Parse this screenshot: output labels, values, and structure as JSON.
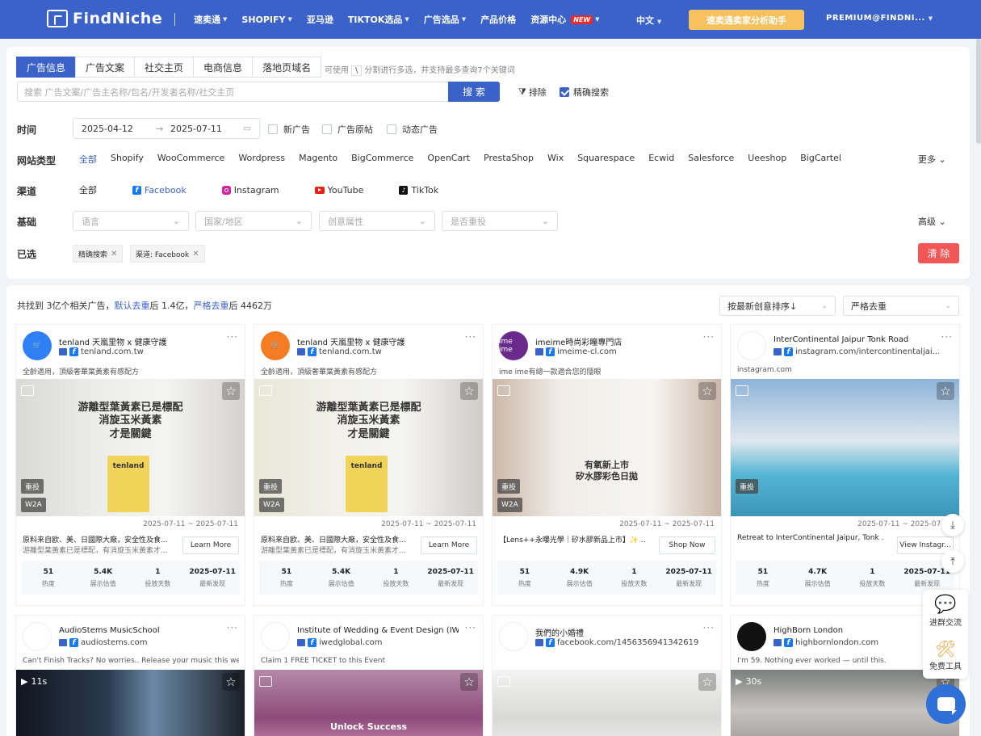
{
  "nav": {
    "logo": "FindNiche",
    "menu": [
      {
        "label": "速卖通",
        "dropdown": true
      },
      {
        "label": "SHOPIFY",
        "dropdown": true
      },
      {
        "label": "亚马逊",
        "dropdown": false
      },
      {
        "label": "TIKTOK选品",
        "dropdown": true
      },
      {
        "label": "广告选品",
        "dropdown": true
      },
      {
        "label": "产品价格",
        "dropdown": false
      },
      {
        "label": "资源中心",
        "dropdown": true,
        "badge": "NEW"
      }
    ],
    "lang": "中文",
    "cta": "速卖通卖家分析助手",
    "user": "PREMIUM@FINDNI..."
  },
  "filters": {
    "tabs": [
      "广告信息",
      "广告文案",
      "社交主页",
      "电商信息",
      "落地页域名"
    ],
    "active_tab": 0,
    "hint_prefix": "可使用",
    "hint_key": "\\",
    "hint_suffix": "分割进行多选，并支持最多查询7个关键词",
    "search_placeholder": "搜索 广告文案/广告主名称/包名/开发者名称/社交主页",
    "search_button": "搜 索",
    "exclude_label": "排除",
    "exact_label": "精确搜索",
    "time_label": "时间",
    "date_start": "2025-04-12",
    "date_end": "2025-07-11",
    "time_options": [
      "新广告",
      "广告原帖",
      "动态广告"
    ],
    "site_label": "网站类型",
    "site_types": [
      "全部",
      "Shopify",
      "WooCommerce",
      "Wordpress",
      "Magento",
      "BigCommerce",
      "OpenCart",
      "PrestaShop",
      "Wix",
      "Squarespace",
      "Ecwid",
      "Salesforce",
      "Ueeshop",
      "BigCartel"
    ],
    "more": "更多",
    "channel_label": "渠道",
    "channels": {
      "all": "全部",
      "facebook": "Facebook",
      "instagram": "Instagram",
      "youtube": "YouTube",
      "tiktok": "TikTok"
    },
    "basic_label": "基础",
    "selects": [
      "语言",
      "国家/地区",
      "创意属性",
      "是否重投"
    ],
    "advanced": "高级",
    "selected_label": "已选",
    "chips": [
      "精确搜索",
      "渠道: Facebook"
    ],
    "clear": "清 除"
  },
  "results": {
    "summary_a": "共找到 3亿个相关广告，",
    "summary_link1": "默认去重",
    "summary_b": "后 1.4亿，",
    "summary_link2": "严格去重",
    "summary_c": "后 4462万",
    "sort": "按最新创意排序↓",
    "dedupe": "严格去重",
    "stat_labels": [
      "热度",
      "展示估值",
      "投放天数",
      "最新发现"
    ]
  },
  "cards": [
    {
      "name": "tenland 天嵐里物 x 健康守護",
      "domain": "tenland.com.tw",
      "desc": "全齡適用，頂級奢華葉黃素有感配方",
      "badges": [
        "重投",
        "W2A"
      ],
      "range": "2025-07-11 ~ 2025-07-11",
      "t1": "原料来自欧、美、日國際大廠，安全性及食...",
      "t2": "游離型葉黃素已是標配，有消旋玉米黃素才...",
      "cta": "Learn More",
      "stats": [
        "51",
        "5.4K",
        "1",
        "2025-07-11"
      ],
      "image_text": "游離型葉黃素已是標配\n消旋玉米黃素\n才是關鍵",
      "product": "tenland",
      "avatar_color": "#2f7ff5"
    },
    {
      "name": "tenland 天嵐里物 x 健康守護",
      "domain": "tenland.com.tw",
      "desc": "全齡適用，頂級奢華葉黃素有感配方",
      "badges": [
        "重投",
        "W2A"
      ],
      "range": "2025-07-11 ~ 2025-07-11",
      "t1": "原料来自欧、美、日國際大廠，安全性及食...",
      "t2": "游離型葉黃素已是標配，有消旋玉米黃素才...",
      "cta": "Learn More",
      "stats": [
        "51",
        "5.4K",
        "1",
        "2025-07-11"
      ],
      "image_text": "游離型葉黃素已是標配\n消旋玉米黃素\n才是關鍵",
      "product": "tenland",
      "avatar_color": "#f57c22"
    },
    {
      "name": "imeime時尚彩瞳專門店",
      "domain": "imeime-cl.com",
      "desc": "ime ime有總一款適合您的隱眼",
      "badges": [
        "重投",
        "W2A"
      ],
      "range": "2025-07-11 ~ 2025-07-11",
      "t1": "【Lens++永曝光學｜矽水膠新品上市】✨ ...",
      "t2": "",
      "cta": "Shop Now",
      "stats": [
        "51",
        "4.9K",
        "1",
        "2025-07-11"
      ],
      "image_text": "有氧新上市\n矽水膠彩色日拋",
      "product": "",
      "avatar_color": "#6a2a8c",
      "avatar_text": "ime ime"
    },
    {
      "name": "InterContinental Jaipur Tonk Road",
      "domain": "instagram.com/intercontinentaljai...",
      "desc": "instagram.com",
      "badges": [
        "重投"
      ],
      "range": "2025-07-11 ~ 2025-07-11",
      "t1": "Retreat to InterContinental Jaipur, Tonk ...",
      "t2": "",
      "cta": "View Instagr...",
      "stats": [
        "51",
        "4.7K",
        "1",
        "2025-07-11"
      ],
      "image_text": "",
      "product": "",
      "avatar_color": "#ffffff"
    },
    {
      "name": "AudioStems MusicSchool",
      "domain": "audiostems.com",
      "desc": "Can't Finish Tracks? No worries.. Release your music this wee...",
      "video": "11s",
      "avatar_color": "#ffffff"
    },
    {
      "name": "Institute of Wedding & Event Design (IWED)",
      "domain": "iwedglobal.com",
      "desc": "Claim 1 FREE TICKET to this Event",
      "image_text": "Unlock Success",
      "avatar_color": "#ffffff"
    },
    {
      "name": "我們的小婚禮",
      "domain": "facebook.com/1456356941342619",
      "desc": "",
      "avatar_color": "#ffffff"
    },
    {
      "name": "HighBorn London",
      "domain": "highbornlondon.com",
      "desc": "I'm 59. Nothing ever worked — until this.",
      "video": "30s",
      "avatar_color": "#111111"
    }
  ],
  "side": {
    "download_icon": "download-icon",
    "top_icon": "back-to-top-icon",
    "group": "进群交流",
    "tools": "免费工具"
  }
}
